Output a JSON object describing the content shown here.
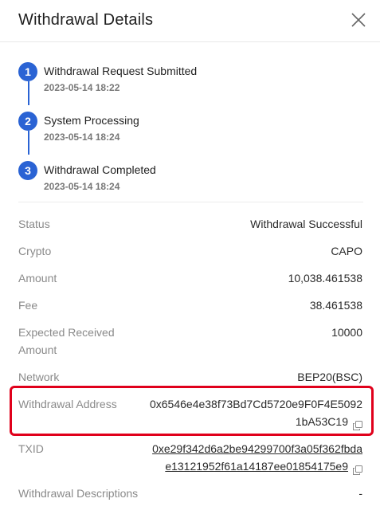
{
  "header": {
    "title": "Withdrawal Details"
  },
  "steps": [
    {
      "num": "1",
      "label": "Withdrawal Request Submitted",
      "time": "2023-05-14 18:22"
    },
    {
      "num": "2",
      "label": "System Processing",
      "time": "2023-05-14 18:24"
    },
    {
      "num": "3",
      "label": "Withdrawal Completed",
      "time": "2023-05-14 18:24"
    }
  ],
  "details": {
    "status": {
      "key": "Status",
      "value": "Withdrawal Successful"
    },
    "crypto": {
      "key": "Crypto",
      "value": "CAPO"
    },
    "amount": {
      "key": "Amount",
      "value": "10,038.461538"
    },
    "fee": {
      "key": "Fee",
      "value": "38.461538"
    },
    "expected": {
      "key_line1": "Expected Received",
      "key_line2": "Amount",
      "value": "10000"
    },
    "network": {
      "key": "Network",
      "value": "BEP20(BSC)"
    },
    "address": {
      "key": "Withdrawal Address",
      "line1": "0x6546e4e38f73Bd7Cd5720e9F0F4E5092",
      "line2": "1bA53C19"
    },
    "txid": {
      "key": "TXID",
      "line1": "0xe29f342d6a2be94299700f3a05f362fbda",
      "line2": "e13121952f61a14187ee01854175e9"
    },
    "descriptions": {
      "key": "Withdrawal Descriptions",
      "value": "-"
    }
  },
  "colors": {
    "accent": "#2a63d4",
    "highlight": "#e0001b"
  }
}
